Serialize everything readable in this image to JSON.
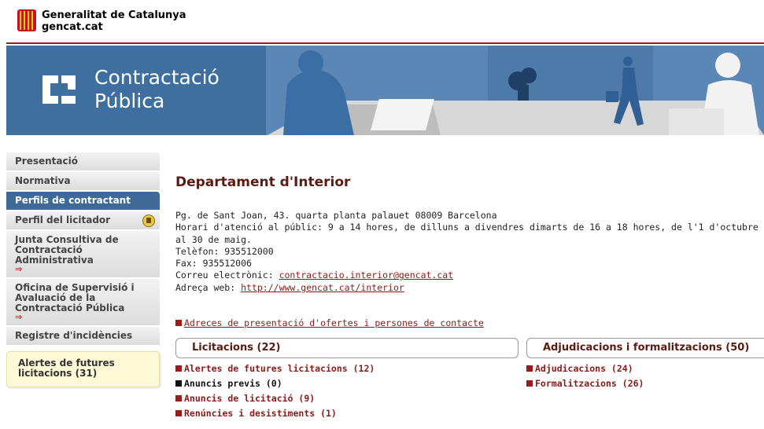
{
  "header": {
    "org_line1": "Generalitat de Catalunya",
    "org_line2": "gencat.cat"
  },
  "banner": {
    "title_line1": "Contractació",
    "title_line2": "Pública"
  },
  "sidebar": {
    "items": [
      {
        "label": "Presentació"
      },
      {
        "label": "Normativa"
      },
      {
        "label": "Perfils de contractant"
      },
      {
        "label": "Perfil del licitador"
      },
      {
        "label": "Junta Consultiva de Contractació Administrativa"
      },
      {
        "label": "Oficina de Supervisió i Avaluació de la Contractació Pública"
      },
      {
        "label": "Registre d'incidències"
      }
    ],
    "external_glyph": "⇒",
    "alerts_label": "Alertes de futures licitacions (31)"
  },
  "main": {
    "title": "Departament d'Interior",
    "address": "Pg. de Sant Joan, 43. quarta planta palauet 08009 Barcelona",
    "hours": "Horari d'atenció al públic: 9 a 14 hores, de dilluns a divendres dimarts de 16 a 18 hores, de l'1 d'octubre al 30 de maig.",
    "phone": "Telèfon: 935512000",
    "fax": "Fax: 935512006",
    "email_label": "Correu electrònic:",
    "email": "contractacio.interior@gencat.cat",
    "web_label": "Adreça web:",
    "web": "http://www.gencat.cat/interior",
    "contacts_link": "Adreces de presentació d'ofertes i persones de contacte"
  },
  "licitacions": {
    "title": "Licitacions (22)",
    "items": [
      {
        "label": "Alertes de futures licitacions (12)"
      },
      {
        "label": "Anuncis previs (0)"
      },
      {
        "label": "Anuncis de licitació (9)"
      },
      {
        "label": "Renúncies i desistiments (1)"
      }
    ]
  },
  "adjudicacions": {
    "title": "Adjudicacions i formalitzacions (50)",
    "items": [
      {
        "label": "Adjudicacions (24)"
      },
      {
        "label": "Formalitzacions (26)"
      }
    ]
  },
  "colors": {
    "accent": "#9b1b1b",
    "nav_active": "#3f6a98",
    "banner": "#3f6f9f"
  }
}
